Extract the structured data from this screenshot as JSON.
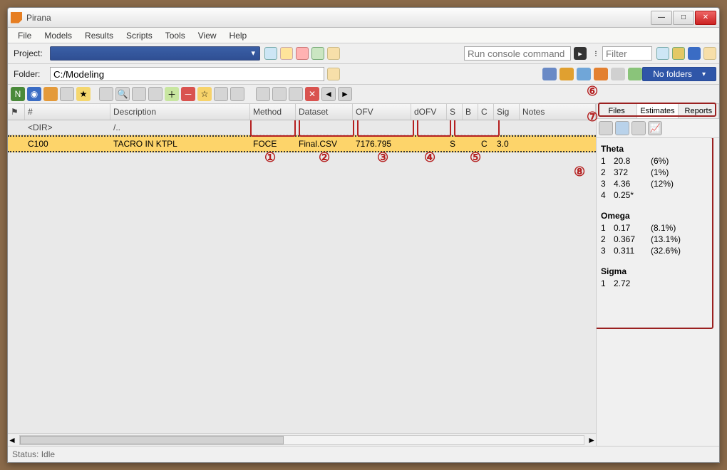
{
  "window": {
    "title": "Pirana"
  },
  "menu": {
    "items": [
      "File",
      "Models",
      "Results",
      "Scripts",
      "Tools",
      "View",
      "Help"
    ]
  },
  "project": {
    "label": "Project:",
    "value": ""
  },
  "folder": {
    "label": "Folder:",
    "value": "C:/Modeling"
  },
  "consolecmd": {
    "placeholder": "Run console command"
  },
  "filter": {
    "placeholder": "Filter"
  },
  "nofolders": {
    "label": "No folders"
  },
  "columns": {
    "num": "#",
    "desc": "Description",
    "method": "Method",
    "dataset": "Dataset",
    "ofv": "OFV",
    "dofv": "dOFV",
    "s": "S",
    "b": "B",
    "c": "C",
    "sig": "Sig",
    "notes": "Notes"
  },
  "rows": [
    {
      "num": "<DIR>",
      "desc": "/..",
      "method": "",
      "dataset": "",
      "ofv": "",
      "dofv": "",
      "s": "",
      "b": "",
      "c": "",
      "sig": "",
      "notes": ""
    },
    {
      "num": "C100",
      "desc": "TACRO IN KTPL",
      "method": "FOCE",
      "dataset": "Final.CSV",
      "ofv": "7176.795",
      "dofv": "",
      "s": "S",
      "b": "",
      "c": "C",
      "sig": "3.0",
      "notes": ""
    }
  ],
  "sidetabs": {
    "files": "Files",
    "estimates": "Estimates",
    "reports": "Reports"
  },
  "estimates": {
    "theta_label": "Theta",
    "theta": [
      {
        "idx": "1",
        "val": "20.8",
        "cv": "(6%)"
      },
      {
        "idx": "2",
        "val": "372",
        "cv": "(1%)"
      },
      {
        "idx": "3",
        "val": "4.36",
        "cv": "(12%)"
      },
      {
        "idx": "4",
        "val": "0.25*",
        "cv": ""
      }
    ],
    "omega_label": "Omega",
    "omega": [
      {
        "idx": "1",
        "val": "0.17",
        "cv": "(8.1%)"
      },
      {
        "idx": "2",
        "val": "0.367",
        "cv": "(13.1%)"
      },
      {
        "idx": "3",
        "val": "0.311",
        "cv": "(32.6%)"
      }
    ],
    "sigma_label": "Sigma",
    "sigma": [
      {
        "idx": "1",
        "val": "2.72",
        "cv": ""
      }
    ]
  },
  "annotations": {
    "a1": "①",
    "a2": "②",
    "a3": "③",
    "a4": "④",
    "a5": "⑤",
    "a6": "⑥",
    "a7": "⑦",
    "a8": "⑧"
  },
  "status": {
    "text": "Status: Idle"
  },
  "scrollplaceholder": "..."
}
